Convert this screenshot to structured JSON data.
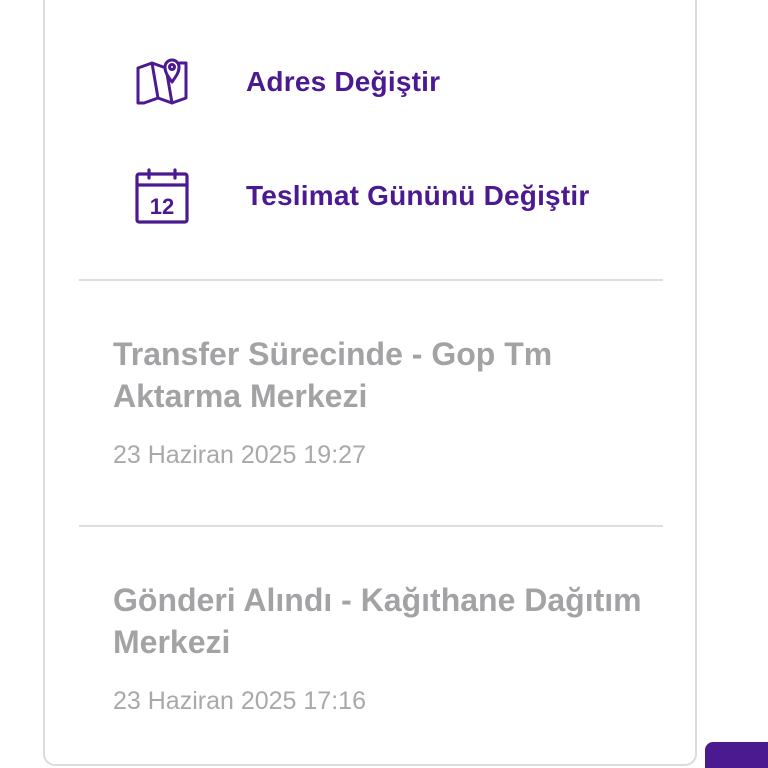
{
  "actions": [
    {
      "label": "Adres Değiştir",
      "icon": "map-pin-icon"
    },
    {
      "label": "Teslimat Gününü Değiştir",
      "icon": "calendar-icon",
      "calendar_day": "12"
    }
  ],
  "timeline": [
    {
      "title": "Transfer Sürecinde - Gop Tm Aktarma Merkezi",
      "time": "23 Haziran 2025 19:27"
    },
    {
      "title": "Gönderi Alındı - Kağıthane Dağıtım Merkezi",
      "time": "23 Haziran 2025 17:16"
    }
  ],
  "colors": {
    "accent": "#4b1a91",
    "muted_text": "#a3a3a6",
    "divider": "#dedede",
    "card_border": "#dcdcdc"
  }
}
